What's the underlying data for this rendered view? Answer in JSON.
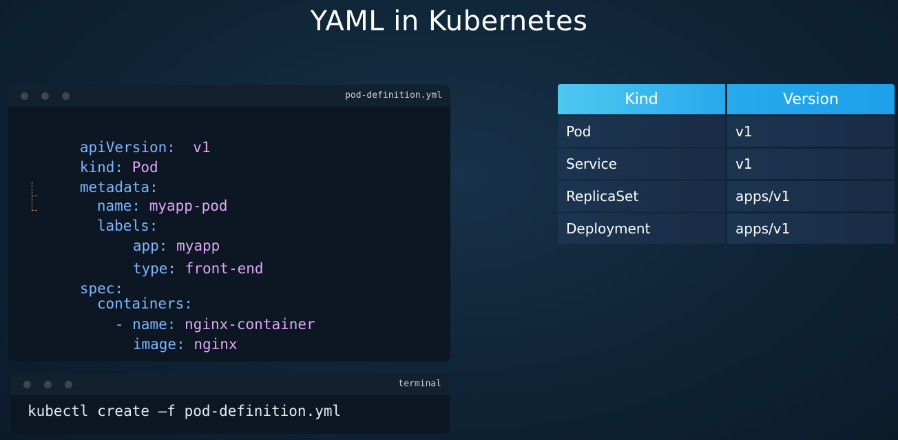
{
  "title": "YAML in Kubernetes",
  "yaml_window": {
    "filename": "pod-definition.yml",
    "lines": [
      {
        "key": "apiVersion:",
        "value": "v1"
      },
      {
        "key": "kind:",
        "value": "Pod"
      },
      {
        "key": "metadata:",
        "value": ""
      },
      {
        "key": "name:",
        "value": "myapp-pod"
      },
      {
        "key": "labels:",
        "value": ""
      },
      {
        "key": "app:",
        "value": "myapp"
      },
      {
        "key": "type:",
        "value": "front-end"
      },
      {
        "key": "spec:",
        "value": ""
      },
      {
        "key": "containers:",
        "value": ""
      },
      {
        "key": "- name:",
        "value": "nginx-container"
      },
      {
        "key": "image:",
        "value": "nginx"
      }
    ]
  },
  "terminal_window": {
    "filename": "terminal",
    "command": "kubectl create –f pod-definition.yml"
  },
  "kind_table": {
    "headers": [
      "Kind",
      "Version"
    ],
    "rows": [
      [
        "Pod",
        "v1"
      ],
      [
        "Service",
        "v1"
      ],
      [
        "ReplicaSet",
        "apps/v1"
      ],
      [
        "Deployment",
        "apps/v1"
      ]
    ]
  },
  "colors": {
    "yaml_key": "#7eb6ff",
    "yaml_value": "#e0a6f5",
    "table_header": "#27a9ec"
  }
}
